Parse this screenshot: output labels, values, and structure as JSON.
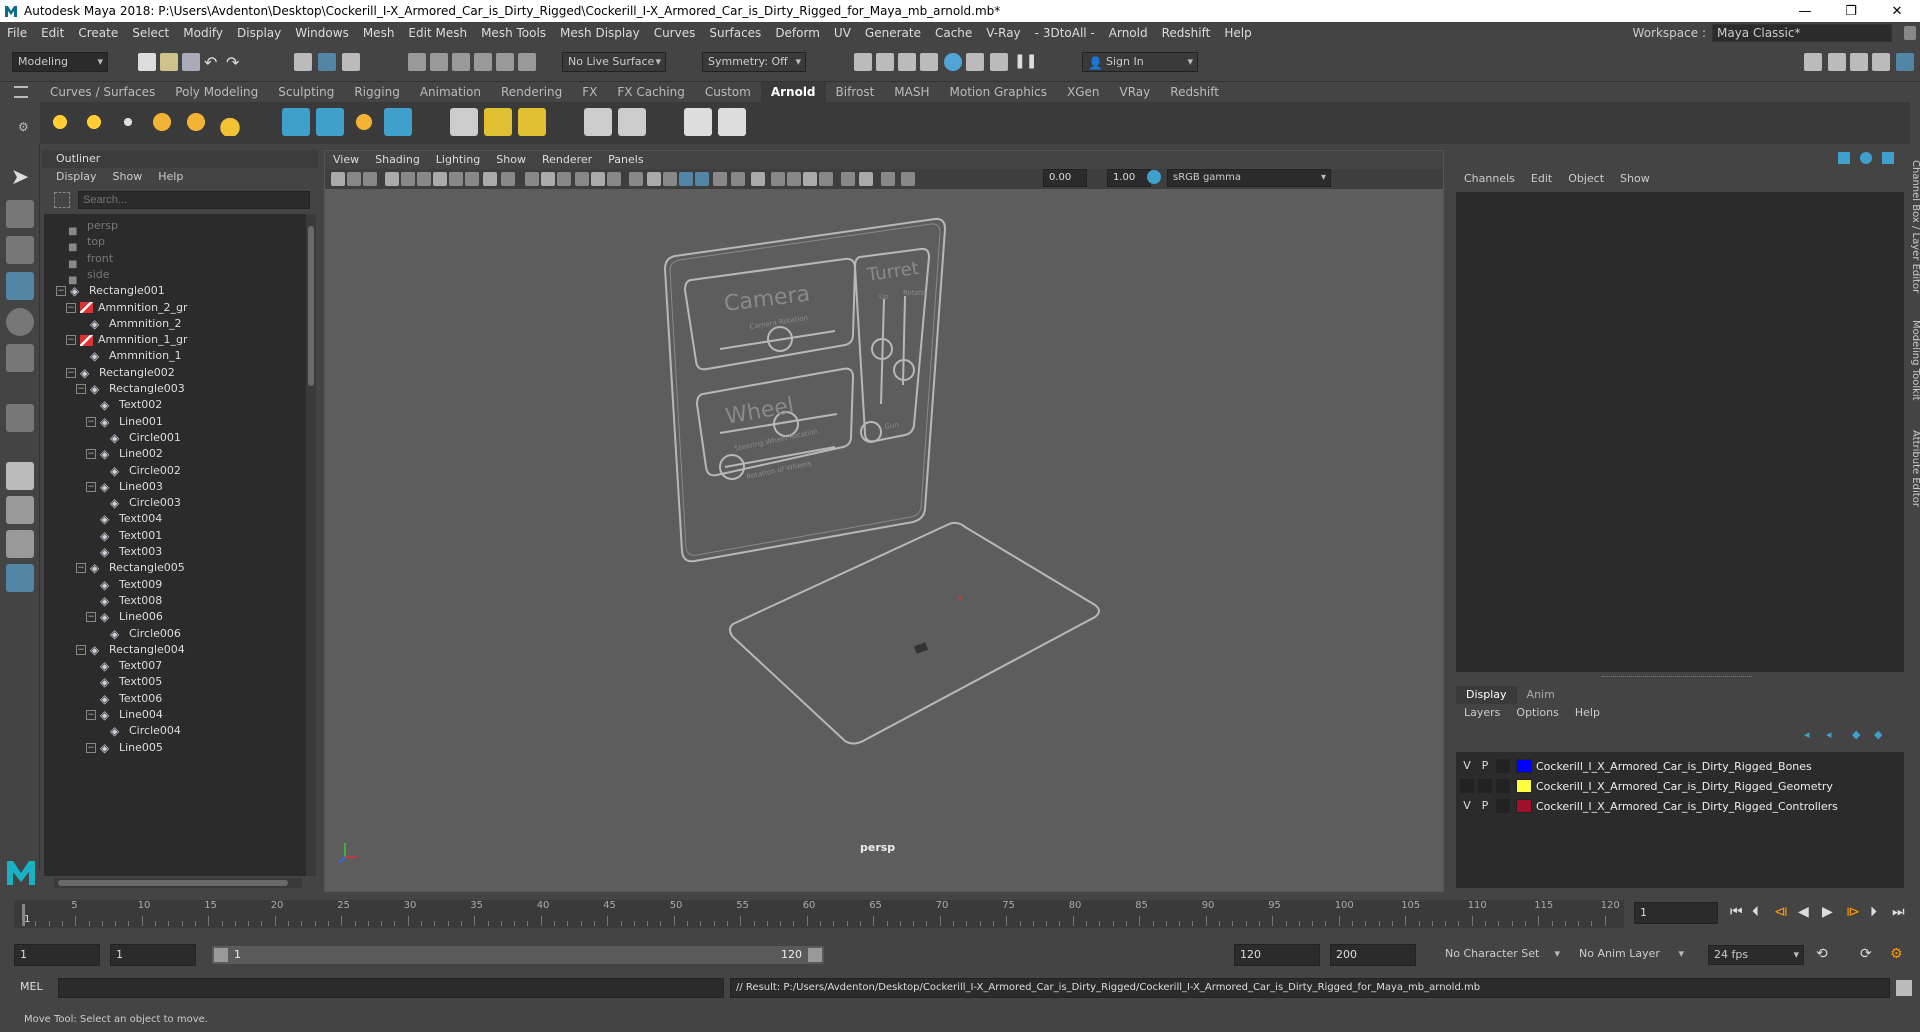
{
  "window": {
    "title": "Autodesk Maya 2018: P:\\Users\\Avdenton\\Desktop\\Cockerill_I-X_Armored_Car_is_Dirty_Rigged\\Cockerill_I-X_Armored_Car_is_Dirty_Rigged_for_Maya_mb_arnold.mb*",
    "minimize": "—",
    "maximize": "❐",
    "close": "✕"
  },
  "menubar": {
    "items": [
      "File",
      "Edit",
      "Create",
      "Select",
      "Modify",
      "Display",
      "Windows",
      "Mesh",
      "Edit Mesh",
      "Mesh Tools",
      "Mesh Display",
      "Curves",
      "Surfaces",
      "Deform",
      "UV",
      "Generate",
      "Cache",
      "V-Ray",
      "- 3DtoAll -",
      "Arnold",
      "Redshift",
      "Help"
    ],
    "workspace_label": "Workspace :",
    "workspace_value": "Maya Classic*"
  },
  "statusline": {
    "mode": "Modeling",
    "live_surface": "No Live Surface",
    "symmetry": "Symmetry: Off",
    "sign_in": "Sign In"
  },
  "shelf": {
    "tabs": [
      "Curves / Surfaces",
      "Poly Modeling",
      "Sculpting",
      "Rigging",
      "Animation",
      "Rendering",
      "FX",
      "FX Caching",
      "Custom",
      "Arnold",
      "Bifrost",
      "MASH",
      "Motion Graphics",
      "XGen",
      "VRay",
      "Redshift"
    ],
    "active_tab": "Arnold"
  },
  "outliner": {
    "title": "Outliner",
    "menu": [
      "Display",
      "Show",
      "Help"
    ],
    "search_placeholder": "Search...",
    "items": [
      {
        "label": "persp",
        "depth": 0,
        "type": "camera",
        "expand": ""
      },
      {
        "label": "top",
        "depth": 0,
        "type": "camera",
        "expand": ""
      },
      {
        "label": "front",
        "depth": 0,
        "type": "camera",
        "expand": ""
      },
      {
        "label": "side",
        "depth": 0,
        "type": "camera",
        "expand": ""
      },
      {
        "label": "Rectangle001",
        "depth": 0,
        "type": "transform",
        "expand": "−"
      },
      {
        "label": "Ammnition_2_gr",
        "depth": 1,
        "type": "shape",
        "expand": "−"
      },
      {
        "label": "Ammnition_2",
        "depth": 2,
        "type": "transform",
        "expand": ""
      },
      {
        "label": "Ammnition_1_gr",
        "depth": 1,
        "type": "shape",
        "expand": "−"
      },
      {
        "label": "Ammnition_1",
        "depth": 2,
        "type": "transform",
        "expand": ""
      },
      {
        "label": "Rectangle002",
        "depth": 1,
        "type": "transform",
        "expand": "−"
      },
      {
        "label": "Rectangle003",
        "depth": 2,
        "type": "transform",
        "expand": "−"
      },
      {
        "label": "Text002",
        "depth": 3,
        "type": "transform",
        "expand": ""
      },
      {
        "label": "Line001",
        "depth": 3,
        "type": "transform",
        "expand": "−"
      },
      {
        "label": "Circle001",
        "depth": 4,
        "type": "transform",
        "expand": ""
      },
      {
        "label": "Line002",
        "depth": 3,
        "type": "transform",
        "expand": "−"
      },
      {
        "label": "Circle002",
        "depth": 4,
        "type": "transform",
        "expand": ""
      },
      {
        "label": "Line003",
        "depth": 3,
        "type": "transform",
        "expand": "−"
      },
      {
        "label": "Circle003",
        "depth": 4,
        "type": "transform",
        "expand": ""
      },
      {
        "label": "Text004",
        "depth": 3,
        "type": "transform",
        "expand": ""
      },
      {
        "label": "Text001",
        "depth": 3,
        "type": "transform",
        "expand": ""
      },
      {
        "label": "Text003",
        "depth": 3,
        "type": "transform",
        "expand": ""
      },
      {
        "label": "Rectangle005",
        "depth": 2,
        "type": "transform",
        "expand": "−"
      },
      {
        "label": "Text009",
        "depth": 3,
        "type": "transform",
        "expand": ""
      },
      {
        "label": "Text008",
        "depth": 3,
        "type": "transform",
        "expand": ""
      },
      {
        "label": "Line006",
        "depth": 3,
        "type": "transform",
        "expand": "−"
      },
      {
        "label": "Circle006",
        "depth": 4,
        "type": "transform",
        "expand": ""
      },
      {
        "label": "Rectangle004",
        "depth": 2,
        "type": "transform",
        "expand": "−"
      },
      {
        "label": "Text007",
        "depth": 3,
        "type": "transform",
        "expand": ""
      },
      {
        "label": "Text005",
        "depth": 3,
        "type": "transform",
        "expand": ""
      },
      {
        "label": "Text006",
        "depth": 3,
        "type": "transform",
        "expand": ""
      },
      {
        "label": "Line004",
        "depth": 3,
        "type": "transform",
        "expand": "−"
      },
      {
        "label": "Circle004",
        "depth": 4,
        "type": "transform",
        "expand": ""
      },
      {
        "label": "Line005",
        "depth": 3,
        "type": "transform",
        "expand": "−"
      }
    ]
  },
  "viewport": {
    "menu": [
      "View",
      "Shading",
      "Lighting",
      "Show",
      "Renderer",
      "Panels"
    ],
    "exposure": "0.00",
    "gamma": "1.00",
    "color_space": "sRGB gamma",
    "camera_label": "persp",
    "panel_text": {
      "camera": "Camera",
      "camera_sub": "Camera Rotation",
      "wheel": "Wheel",
      "wheel_sub1": "Steering Wheel Rotation",
      "wheel_sub2": "Rotation of Wheels",
      "turret": "Turret",
      "turret_sub1": "Up",
      "turret_sub2": "Rotate",
      "turret_sub3": "Gun"
    }
  },
  "channelbox": {
    "menu": [
      "Channels",
      "Edit",
      "Object",
      "Show"
    ],
    "layer_tabs": [
      "Display",
      "Anim"
    ],
    "active_layer_tab": "Display",
    "layer_menu": [
      "Layers",
      "Options",
      "Help"
    ],
    "layers": [
      {
        "v": "V",
        "p": "P",
        "name": "Cockerill_I_X_Armored_Car_is_Dirty_Rigged_Bones",
        "color": "#0000ff"
      },
      {
        "v": "",
        "p": "",
        "name": "Cockerill_I_X_Armored_Car_is_Dirty_Rigged_Geometry",
        "color": "#ffff40"
      },
      {
        "v": "V",
        "p": "P",
        "name": "Cockerill_I_X_Armored_Car_is_Dirty_Rigged_Controllers",
        "color": "#a0102a"
      }
    ]
  },
  "sidetabs": [
    "Channel Box / Layer Editor",
    "Modeling Toolkit",
    "Attribute Editor"
  ],
  "timeline": {
    "ticks": [
      5,
      10,
      15,
      20,
      25,
      30,
      35,
      40,
      45,
      50,
      55,
      60,
      65,
      70,
      75,
      80,
      85,
      90,
      95,
      100,
      105,
      110,
      115,
      120
    ],
    "current_frame": "1",
    "current_frame_field": "1"
  },
  "range": {
    "start": "1",
    "playback_start": "1",
    "slider_start": "1",
    "slider_end": "120",
    "playback_end": "120",
    "end": "200",
    "character_set": "No Character Set",
    "anim_layer": "No Anim Layer",
    "fps": "24 fps"
  },
  "command": {
    "lang": "MEL",
    "result": "// Result: P:/Users/Avdenton/Desktop/Cockerill_I-X_Armored_Car_is_Dirty_Rigged/Cockerill_I-X_Armored_Car_is_Dirty_Rigged_for_Maya_mb_arnold.mb"
  },
  "helpline": "Move Tool: Select an object to move.",
  "icons": {
    "logo": "maya-logo-icon",
    "select_tool": "select-arrow-icon",
    "move_tool": "move-tool-icon",
    "play": "play-icon"
  },
  "colors": {
    "accent": "#5285a6",
    "panel": "#444444",
    "field": "#2b2b2b",
    "viewport_bg": "#5d5d5d",
    "maya_logo": "#19b2c5"
  }
}
